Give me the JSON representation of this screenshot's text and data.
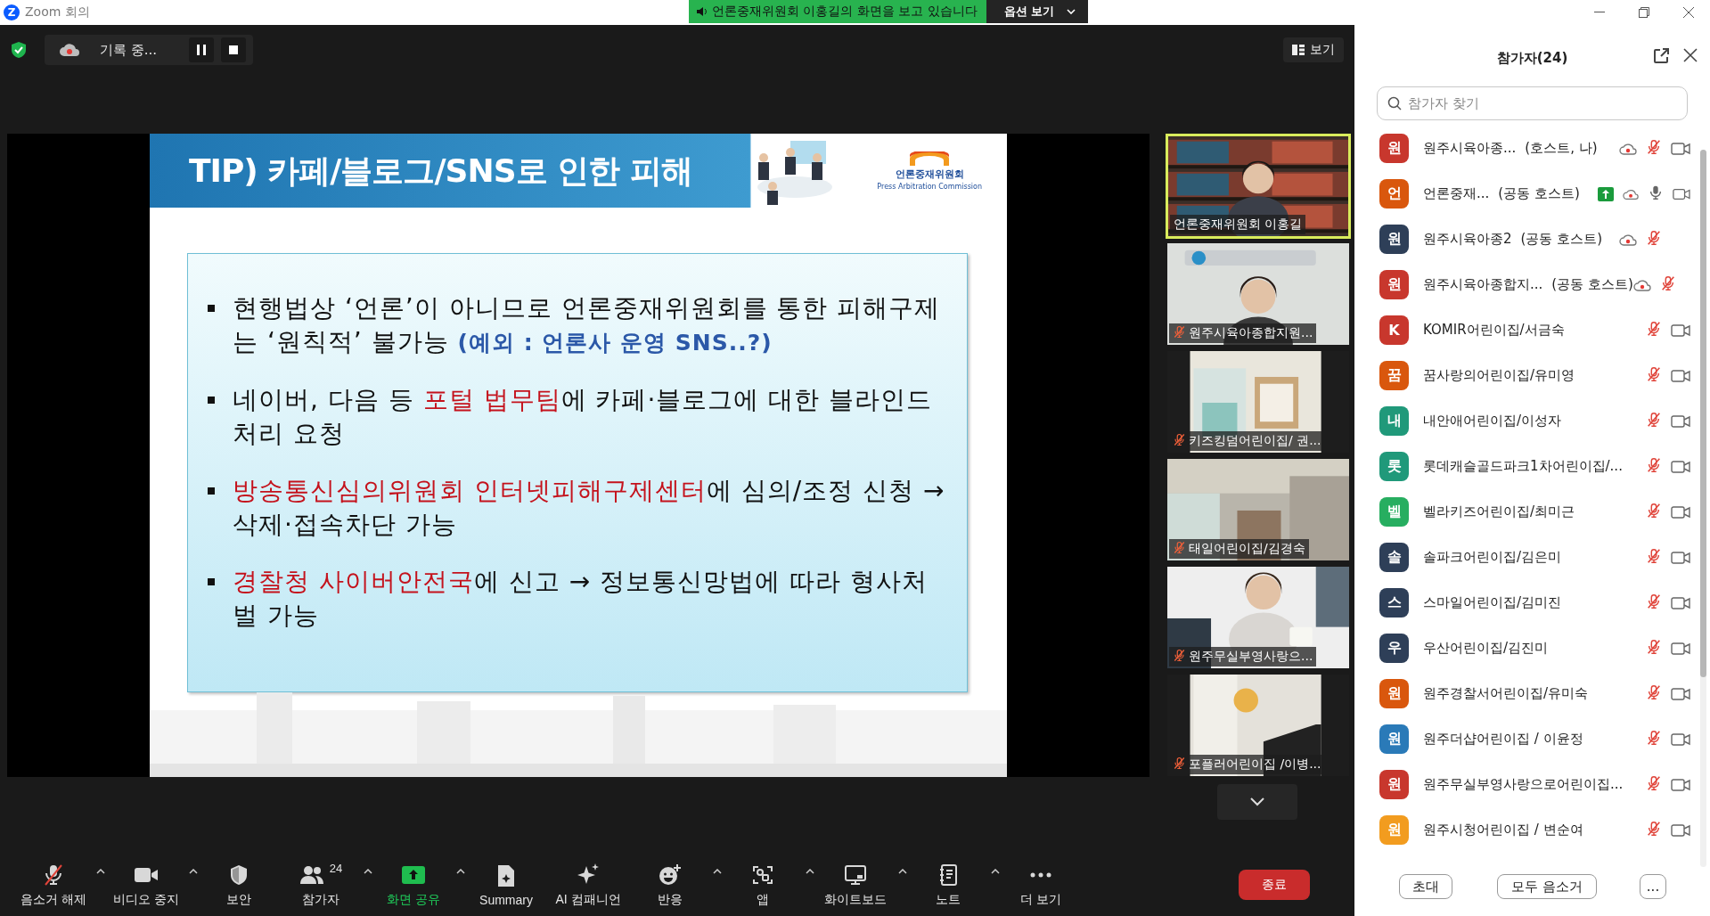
{
  "window": {
    "logo": "Z",
    "title": "Zoom 회의"
  },
  "share_banner": {
    "text": "언론중재위원회 이홍길의 화면을 보고 있습니다",
    "options_button": "옵션 보기"
  },
  "top_bar": {
    "recording_label": "기록 중...",
    "view_button": "보기"
  },
  "slide": {
    "title": "TIP) 카페/블로그/SNS로 인한 피해",
    "logo_name": "언론중재위원회",
    "logo_subtitle": "Press Arbitration Commission",
    "bullets": [
      [
        {
          "text": "현행법상 ‘언론’이 아니므로 언론중재위원회를 통한 피해구제는 ‘원칙적’ 불가능 ",
          "kind": "plain"
        },
        {
          "text": "(예외 : 언론사 운영 SNS..?)",
          "kind": "note"
        }
      ],
      [
        {
          "text": "네이버, 다음 등 ",
          "kind": "plain"
        },
        {
          "text": "포털 법무팀",
          "kind": "highlight"
        },
        {
          "text": "에 카페·블로그에 대한 블라인드 처리 요청",
          "kind": "plain"
        }
      ],
      [
        {
          "text": "방송통신심의위원회 인터넷피해구제센터",
          "kind": "highlight"
        },
        {
          "text": "에 심의/조정 신청 → 삭제·접속차단 가능",
          "kind": "plain"
        }
      ],
      [
        {
          "text": "경찰청 사이버안전국",
          "kind": "highlight"
        },
        {
          "text": "에 신고 → 정보통신망법에 따라 형사처벌 가능",
          "kind": "plain"
        }
      ]
    ]
  },
  "video_tiles": [
    {
      "name": "언론중재위원회 이홍길",
      "muted": false,
      "active": true
    },
    {
      "name": "원주시육아종합지원...",
      "muted": true,
      "active": false
    },
    {
      "name": "키즈킹덤어린이집/ 권...",
      "muted": true,
      "active": false
    },
    {
      "name": "태일어린이집/김경숙",
      "muted": true,
      "active": false
    },
    {
      "name": "원주무실부영사랑으...",
      "muted": true,
      "active": false
    },
    {
      "name": "포플러어린이집 /이병...",
      "muted": true,
      "active": false
    }
  ],
  "toolbar": [
    {
      "kind": "mic",
      "label": "음소거 해제",
      "menu": true,
      "active": false
    },
    {
      "kind": "video",
      "label": "비디오 중지",
      "menu": true,
      "active": false
    },
    {
      "kind": "security",
      "label": "보안",
      "menu": false,
      "active": false
    },
    {
      "kind": "participants",
      "label": "참가자",
      "count": "24",
      "menu": true,
      "active": false
    },
    {
      "kind": "share",
      "label": "화면 공유",
      "menu": true,
      "active": true
    },
    {
      "kind": "summary",
      "label": "Summary",
      "menu": false,
      "active": false
    },
    {
      "kind": "ai",
      "label": "AI 컴패니언",
      "menu": false,
      "active": false
    },
    {
      "kind": "reactions",
      "label": "반응",
      "menu": true,
      "active": false
    },
    {
      "kind": "apps",
      "label": "앱",
      "menu": true,
      "active": false
    },
    {
      "kind": "whiteboard",
      "label": "화이트보드",
      "menu": true,
      "active": false
    },
    {
      "kind": "notes",
      "label": "노트",
      "menu": true,
      "active": false
    },
    {
      "kind": "more",
      "label": "더 보기",
      "menu": false,
      "active": false
    }
  ],
  "end_button": "종료",
  "participants_panel": {
    "title": "참가자(24)",
    "search": {
      "placeholder": "참가자 찾기"
    },
    "participants": [
      {
        "initial": "원",
        "color": "#c8372d",
        "name": "원주시육아종...",
        "role": "(호스트, 나)",
        "sharing": false,
        "recording": true,
        "muted": true,
        "camera": true
      },
      {
        "initial": "언",
        "color": "#d9570d",
        "name": "언론중재...",
        "role": "(공동 호스트)",
        "sharing": true,
        "recording": true,
        "muted": false,
        "camera": true
      },
      {
        "initial": "원",
        "color": "#2e3f58",
        "name": "원주시육아종2",
        "role": "(공동 호스트)",
        "sharing": false,
        "recording": true,
        "muted": true,
        "camera": false
      },
      {
        "initial": "원",
        "color": "#c8372d",
        "name": "원주시육아종합지...",
        "role": "(공동 호스트)",
        "sharing": false,
        "recording": true,
        "muted": true,
        "camera": false
      },
      {
        "initial": "K",
        "color": "#c8372d",
        "name": "KOMIR어린이집/서금숙",
        "sharing": false,
        "recording": false,
        "muted": true,
        "camera": true
      },
      {
        "initial": "꿈",
        "color": "#d9570d",
        "name": "꿈사랑의어린이집/유미영",
        "sharing": false,
        "recording": false,
        "muted": true,
        "camera": true
      },
      {
        "initial": "내",
        "color": "#20997a",
        "name": "내안애어린이집/이성자",
        "sharing": false,
        "recording": false,
        "muted": true,
        "camera": true
      },
      {
        "initial": "롯",
        "color": "#20997a",
        "name": "롯데캐슬골드파크1차어린이집/...",
        "sharing": false,
        "recording": false,
        "muted": true,
        "camera": true
      },
      {
        "initial": "벨",
        "color": "#27ae60",
        "name": "벨라키즈어린이집/최미근",
        "sharing": false,
        "recording": false,
        "muted": true,
        "camera": true
      },
      {
        "initial": "솔",
        "color": "#2e3f58",
        "name": "솔파크어린이집/김은미",
        "sharing": false,
        "recording": false,
        "muted": true,
        "camera": true
      },
      {
        "initial": "스",
        "color": "#2e3f58",
        "name": "스마일어린이집/김미진",
        "sharing": false,
        "recording": false,
        "muted": true,
        "camera": true
      },
      {
        "initial": "우",
        "color": "#2e3f58",
        "name": "우산어린이집/김진미",
        "sharing": false,
        "recording": false,
        "muted": true,
        "camera": true
      },
      {
        "initial": "원",
        "color": "#d9570d",
        "name": "원주경찰서어린이집/유미숙",
        "sharing": false,
        "recording": false,
        "muted": true,
        "camera": true
      },
      {
        "initial": "원",
        "color": "#2a7ab8",
        "name": "원주더샵어린이집 / 이윤정",
        "sharing": false,
        "recording": false,
        "muted": true,
        "camera": true
      },
      {
        "initial": "원",
        "color": "#c8372d",
        "name": "원주무실부영사랑으로어린이집...",
        "sharing": false,
        "recording": false,
        "muted": true,
        "camera": true
      },
      {
        "initial": "원",
        "color": "#f29c1f",
        "name": "원주시청어린이집 / 변순여",
        "sharing": false,
        "recording": false,
        "muted": true,
        "camera": true
      }
    ],
    "buttons": [
      "초대",
      "모두 음소거"
    ],
    "more_button": "..."
  }
}
